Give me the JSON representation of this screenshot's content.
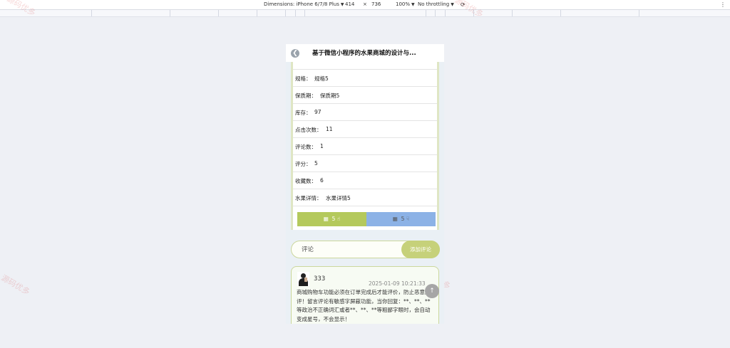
{
  "devtools": {
    "device_label": "Dimensions: iPhone 6/7/8 Plus",
    "width": "414",
    "times": "×",
    "height": "736",
    "zoom": "100%",
    "throttling": "No throttling"
  },
  "page": {
    "title": "基于微信小程序的水果商城的设计与...",
    "back_icon": "back-arrow-icon"
  },
  "details": [
    {
      "label": "规格：",
      "value": "规格5"
    },
    {
      "label": "保质期：",
      "value": "保质期5"
    },
    {
      "label": "库存：",
      "value": "97"
    },
    {
      "label": "点击次数：",
      "value": "11"
    },
    {
      "label": "评论数：",
      "value": "1"
    },
    {
      "label": "评分：",
      "value": "5"
    },
    {
      "label": "收藏数：",
      "value": "6"
    },
    {
      "label": "水果详情：",
      "value": "水果详情5"
    }
  ],
  "votes": {
    "up_count": "5",
    "down_count": "5",
    "up_color": "#b4c95c",
    "down_color": "#8cb2e6"
  },
  "comment_form": {
    "placeholder": "评论",
    "add_label": "添加评论"
  },
  "comment": {
    "user": "333",
    "time": "2025-01-09 10:21:33",
    "text": "商城购物车功能必须在订单完成后才能评价，防止恶意刷评！留言评论有敏感字屏蔽功能，当你回复：**、**、**等政治不正确词汇或者**、**、**等粗鄙字眼时，会自动变成星号，不会显示！"
  },
  "watermark": "源码优多"
}
